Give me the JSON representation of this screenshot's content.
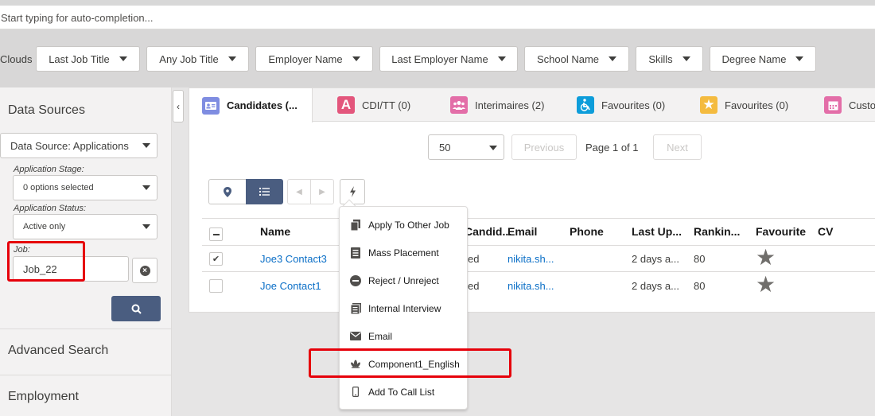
{
  "search": {
    "placeholder": "Start typing for auto-completion..."
  },
  "filters": {
    "label": "Clouds",
    "buttons": [
      "Last Job Title",
      "Any Job Title",
      "Employer Name",
      "Last Employer Name",
      "School Name",
      "Skills",
      "Degree Name"
    ]
  },
  "left_panel": {
    "title": "Data Sources",
    "data_source": "Data Source: Applications",
    "application_stage_label": "Application Stage:",
    "application_stage_value": "0 options selected",
    "application_status_label": "Application Status:",
    "application_status_value": "Active only",
    "job_label": "Job:",
    "job_value": "Job_22",
    "sections": [
      "Advanced Search",
      "Employment"
    ]
  },
  "tabs": [
    {
      "label": "Candidates (...",
      "icon": "contact-card-icon",
      "color": "#7f8de1"
    },
    {
      "label": "CDI/TT (0)",
      "icon": "letter-a-icon",
      "color": "#e3567c"
    },
    {
      "label": "Interimaires (2)",
      "icon": "group-icon",
      "color": "#e36ea8"
    },
    {
      "label": "Favourites (0)",
      "icon": "accessibility-icon",
      "color": "#0d9dda"
    },
    {
      "label": "Favourites (0)",
      "icon": "star-icon",
      "color": "#f4bb3f"
    },
    {
      "label": "Custo",
      "icon": "calendar-icon",
      "color": "#e36ea8"
    }
  ],
  "pagination": {
    "page_size": "50",
    "previous": "Previous",
    "page_info": "Page 1 of 1",
    "next": "Next"
  },
  "table": {
    "columns": [
      "Name",
      "Candid...",
      "Email",
      "Phone",
      "Last Up...",
      "Rankin...",
      "Favourite",
      "CV"
    ],
    "rows": [
      {
        "checked": true,
        "name": "Joe3 Contact3",
        "status": "ed",
        "email": "nikita.sh...",
        "phone": "",
        "last_updated": "2 days a...",
        "ranking": "80"
      },
      {
        "checked": false,
        "name": "Joe Contact1",
        "status": "ed",
        "email": "nikita.sh...",
        "phone": "",
        "last_updated": "2 days a...",
        "ranking": "80"
      }
    ]
  },
  "actions_menu": {
    "items": [
      {
        "label": "Apply To Other Job",
        "icon": "document-copy-icon"
      },
      {
        "label": "Mass Placement",
        "icon": "list-document-icon"
      },
      {
        "label": "Reject / Unreject",
        "icon": "minus-circle-icon"
      },
      {
        "label": "Internal Interview",
        "icon": "notes-icon"
      },
      {
        "label": "Email",
        "icon": "envelope-icon"
      },
      {
        "label": "Component1_English",
        "icon": "lotus-icon"
      },
      {
        "label": "Add To Call List",
        "icon": "phone-icon"
      }
    ]
  },
  "colors": {
    "highlight": "#e6000a",
    "link": "#0b6fc7",
    "primary_button": "#4a5d80",
    "active_toggle": "#4a5d80"
  }
}
